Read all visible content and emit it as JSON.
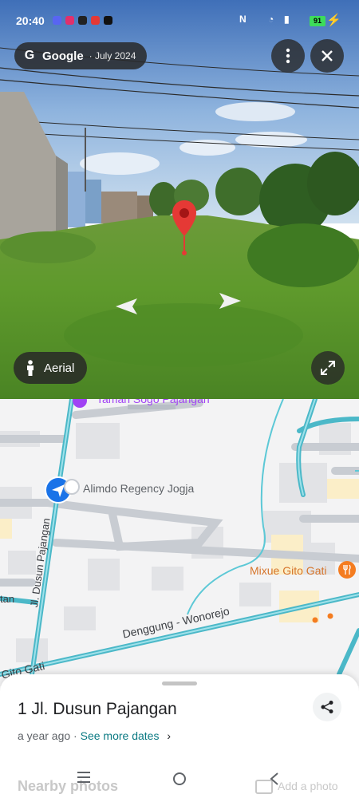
{
  "status_bar": {
    "time": "20:40",
    "battery": "91"
  },
  "streetview": {
    "brand": "Google",
    "date": " · July 2024",
    "aerial_label": "Aerial"
  },
  "map": {
    "labels": {
      "top_partial": "Taman Sogo Pajangan",
      "regency": "Alimdo Regency Jogja",
      "mixue": "Mixue Gito Gati",
      "road_dusun": "Jl. Dusun Pajangan",
      "road_denggung": "Denggung - Wonorejo",
      "road_gito": "Gito Gati",
      "left_partial": "tan"
    }
  },
  "sheet": {
    "title": "1 Jl. Dusun Pajangan",
    "age": "a year ago",
    "sep": " · ",
    "see_more": "See more dates",
    "nearby": "Nearby photos",
    "add_photo": "Add a photo"
  },
  "colors": {
    "road_teal": "#4bb8c8",
    "map_bg": "#f3f3f4",
    "link": "#0b7a83",
    "pin_red": "#e53935"
  }
}
